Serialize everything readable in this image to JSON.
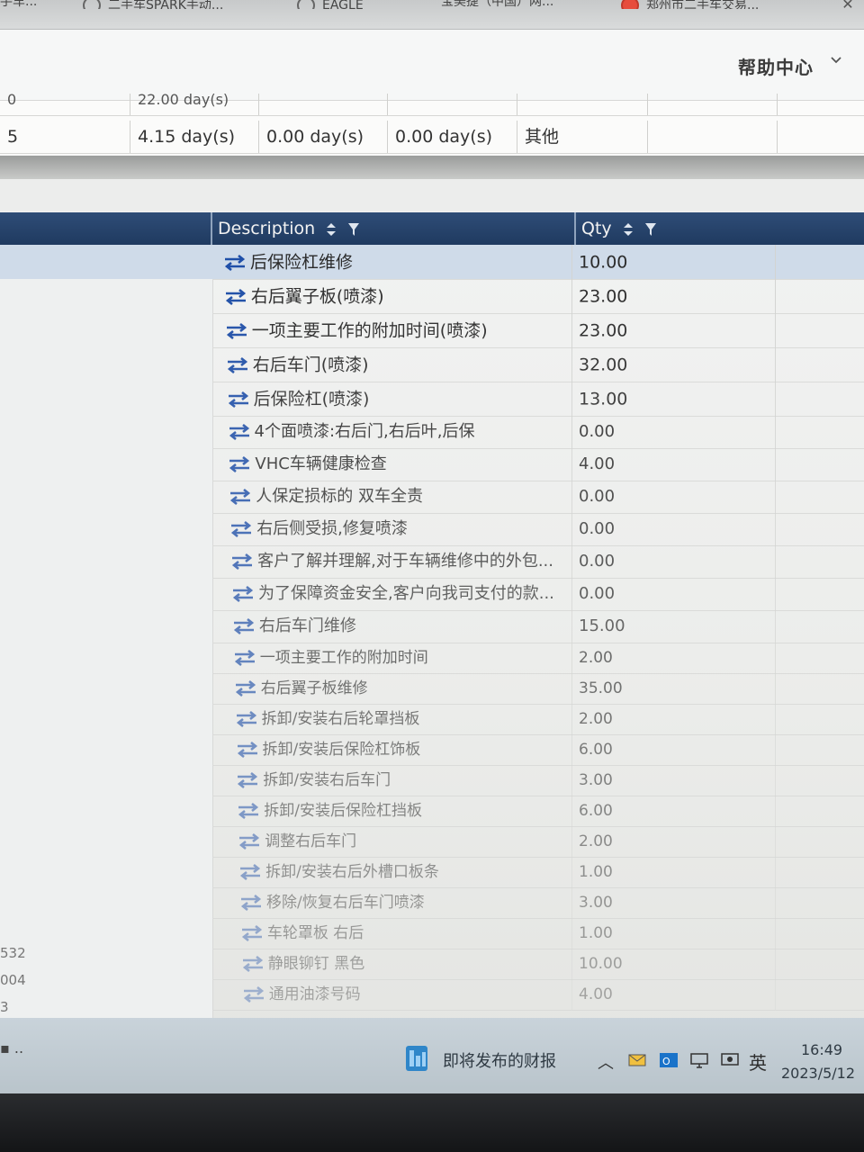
{
  "browser": {
    "tabs": [
      {
        "label": "手车...",
        "icon": "page-icon"
      },
      {
        "label": "二手车SPARK手动...",
        "icon": "globe-icon"
      },
      {
        "label": "EAGLE",
        "icon": "globe-icon"
      },
      {
        "label": "宝美捷（中国）网...",
        "icon": "none"
      },
      {
        "label": "郑州市二手车交易...",
        "icon": "red-logo-icon"
      }
    ]
  },
  "header": {
    "help_label": "帮助中心"
  },
  "upper_table": {
    "partial_row": [
      "0",
      "22.00 day(s)"
    ],
    "row": [
      "5",
      "4.15 day(s)",
      "0.00 day(s)",
      "0.00 day(s)",
      "其他"
    ]
  },
  "grid": {
    "columns": [
      {
        "label": "Description"
      },
      {
        "label": "Qty"
      }
    ],
    "rows": [
      {
        "description": "后保险杠维修",
        "qty": "10.00"
      },
      {
        "description": "右后翼子板(喷漆)",
        "qty": "23.00"
      },
      {
        "description": "一项主要工作的附加时间(喷漆)",
        "qty": "23.00"
      },
      {
        "description": "右后车门(喷漆)",
        "qty": "32.00"
      },
      {
        "description": "后保险杠(喷漆)",
        "qty": "13.00"
      },
      {
        "description": "4个面喷漆:右后门,右后叶,后保",
        "qty": "0.00"
      },
      {
        "description": "VHC车辆健康检查",
        "qty": "4.00"
      },
      {
        "description": "人保定损标的 双车全责",
        "qty": "0.00"
      },
      {
        "description": "右后侧受损,修复喷漆",
        "qty": "0.00"
      },
      {
        "description": "客户了解并理解,对于车辆维修中的外包...",
        "qty": "0.00"
      },
      {
        "description": "为了保障资金安全,客户向我司支付的款...",
        "qty": "0.00"
      },
      {
        "description": "右后车门维修",
        "qty": "15.00"
      },
      {
        "description": "一项主要工作的附加时间",
        "qty": "2.00"
      },
      {
        "description": "右后翼子板维修",
        "qty": "35.00"
      },
      {
        "description": "拆卸/安装右后轮罩挡板",
        "qty": "2.00"
      },
      {
        "description": "拆卸/安装后保险杠饰板",
        "qty": "6.00"
      },
      {
        "description": "拆卸/安装右后车门",
        "qty": "3.00"
      },
      {
        "description": "拆卸/安装后保险杠挡板",
        "qty": "6.00"
      },
      {
        "description": "调整右后车门",
        "qty": "2.00"
      },
      {
        "description": "拆卸/安装右后外槽口板条",
        "qty": "1.00"
      },
      {
        "description": "移除/恢复右后车门喷漆",
        "qty": "3.00"
      },
      {
        "description": "车轮罩板 右后",
        "qty": "1.00"
      },
      {
        "description": "静眼铆钉 黑色",
        "qty": "10.00"
      },
      {
        "description": "通用油漆号码",
        "qty": "4.00"
      }
    ],
    "left_numbers": [
      "532",
      "004",
      "3"
    ]
  },
  "taskbar": {
    "news_label": "即将发布的财报",
    "lang": "英",
    "time": "16:49",
    "date": "2023/5/12"
  },
  "colors": {
    "header_bg": "#1f3a60",
    "selected_row": "#cfdbe9",
    "swap_icon": "#1f4fa8"
  }
}
